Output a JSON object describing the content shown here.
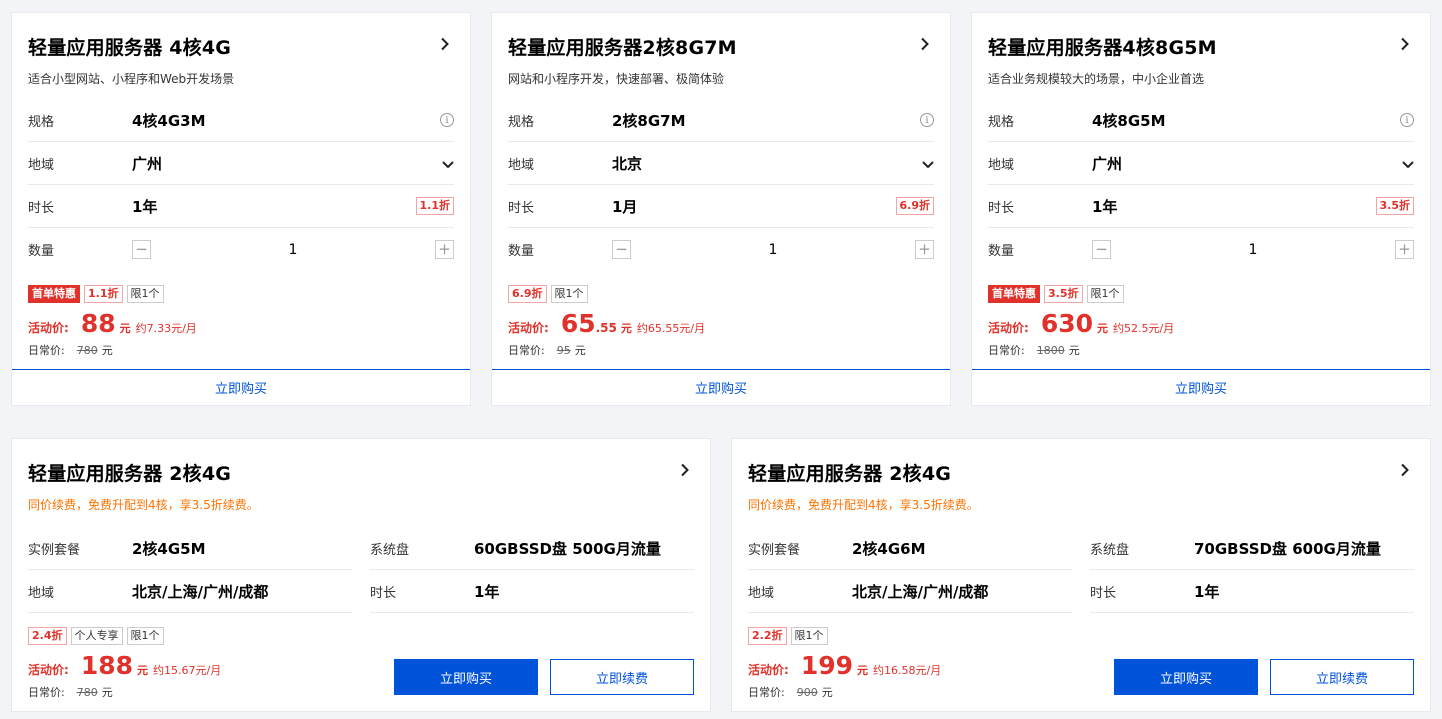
{
  "top_cards": [
    {
      "title": "轻量应用服务器 4核4G",
      "subtitle": "适合小型网站、小程序和Web开发场景",
      "spec_label": "规格",
      "spec_value": "4核4G3M",
      "region_label": "地域",
      "region_value": "广州",
      "duration_label": "时长",
      "duration_value": "1年",
      "duration_discount": "1.1折",
      "qty_label": "数量",
      "qty_value": "1",
      "qty_minus": "−",
      "qty_plus": "+",
      "tags": [
        {
          "text": "首单特惠",
          "style": "red-fill"
        },
        {
          "text": "1.1折",
          "style": "red-line"
        },
        {
          "text": "限1个",
          "style": "plain"
        }
      ],
      "price_label": "活动价:",
      "price_int": "88",
      "price_dec": "",
      "price_unit": "元",
      "price_monthly": "约7.33元/月",
      "orig_label": "日常价:",
      "orig_price": "780",
      "orig_unit": "元",
      "buy_label": "立即购买"
    },
    {
      "title": "轻量应用服务器2核8G7M",
      "subtitle": "网站和小程序开发，快速部署、极简体验",
      "spec_label": "规格",
      "spec_value": "2核8G7M",
      "region_label": "地域",
      "region_value": "北京",
      "duration_label": "时长",
      "duration_value": "1月",
      "duration_discount": "6.9折",
      "qty_label": "数量",
      "qty_value": "1",
      "qty_minus": "−",
      "qty_plus": "+",
      "tags": [
        {
          "text": "6.9折",
          "style": "red-line"
        },
        {
          "text": "限1个",
          "style": "plain"
        }
      ],
      "price_label": "活动价:",
      "price_int": "65",
      "price_dec": ".55",
      "price_unit": "元",
      "price_monthly": "约65.55元/月",
      "orig_label": "日常价:",
      "orig_price": "95",
      "orig_unit": "元",
      "buy_label": "立即购买"
    },
    {
      "title": "轻量应用服务器4核8G5M",
      "subtitle": "适合业务规模较大的场景，中小企业首选",
      "spec_label": "规格",
      "spec_value": "4核8G5M",
      "region_label": "地域",
      "region_value": "广州",
      "duration_label": "时长",
      "duration_value": "1年",
      "duration_discount": "3.5折",
      "qty_label": "数量",
      "qty_value": "1",
      "qty_minus": "−",
      "qty_plus": "+",
      "tags": [
        {
          "text": "首单特惠",
          "style": "red-fill"
        },
        {
          "text": "3.5折",
          "style": "red-line"
        },
        {
          "text": "限1个",
          "style": "plain"
        }
      ],
      "price_label": "活动价:",
      "price_int": "630",
      "price_dec": "",
      "price_unit": "元",
      "price_monthly": "约52.5元/月",
      "orig_label": "日常价:",
      "orig_price": "1800",
      "orig_unit": "元",
      "buy_label": "立即购买"
    }
  ],
  "bottom_cards": [
    {
      "title": "轻量应用服务器 2核4G",
      "subtitle_a": "同价续费，免费升配到4核，享",
      "subtitle_b": "3.5折续费",
      "subtitle_c": "。",
      "pkg_label": "实例套餐",
      "pkg_value": "2核4G5M",
      "disk_label": "系统盘",
      "disk_value": "60GBSSD盘 500G月流量",
      "region_label": "地域",
      "region_value": "北京/上海/广州/成都",
      "duration_label": "时长",
      "duration_value": "1年",
      "tags": [
        {
          "text": "2.4折",
          "style": "red-line"
        },
        {
          "text": "个人专享",
          "style": "plain"
        },
        {
          "text": "限1个",
          "style": "plain"
        }
      ],
      "price_label": "活动价:",
      "price_int": "188",
      "price_unit": "元",
      "price_monthly": "约15.67元/月",
      "orig_label": "日常价:",
      "orig_price": "780",
      "orig_unit": "元",
      "buy_label": "立即购买",
      "renew_label": "立即续费"
    },
    {
      "title": "轻量应用服务器 2核4G",
      "subtitle_a": "同价续费，免费升配到4核，享",
      "subtitle_b": "3.5折续费",
      "subtitle_c": "。",
      "pkg_label": "实例套餐",
      "pkg_value": "2核4G6M",
      "disk_label": "系统盘",
      "disk_value": "70GBSSD盘 600G月流量",
      "region_label": "地域",
      "region_value": "北京/上海/广州/成都",
      "duration_label": "时长",
      "duration_value": "1年",
      "tags": [
        {
          "text": "2.2折",
          "style": "red-line"
        },
        {
          "text": "限1个",
          "style": "plain"
        }
      ],
      "price_label": "活动价:",
      "price_int": "199",
      "price_unit": "元",
      "price_monthly": "约16.58元/月",
      "orig_label": "日常价:",
      "orig_price": "900",
      "orig_unit": "元",
      "buy_label": "立即购买",
      "renew_label": "立即续费"
    }
  ],
  "icons": {
    "chevron_right": "chevron-right-icon",
    "chevron_down": "chevron-down-icon",
    "info": "info-icon",
    "info_glyph": "i"
  },
  "colors": {
    "accent": "#0052d9",
    "price_red": "#e0312a",
    "promo_orange": "#ff7200",
    "background": "#f3f4f7"
  }
}
